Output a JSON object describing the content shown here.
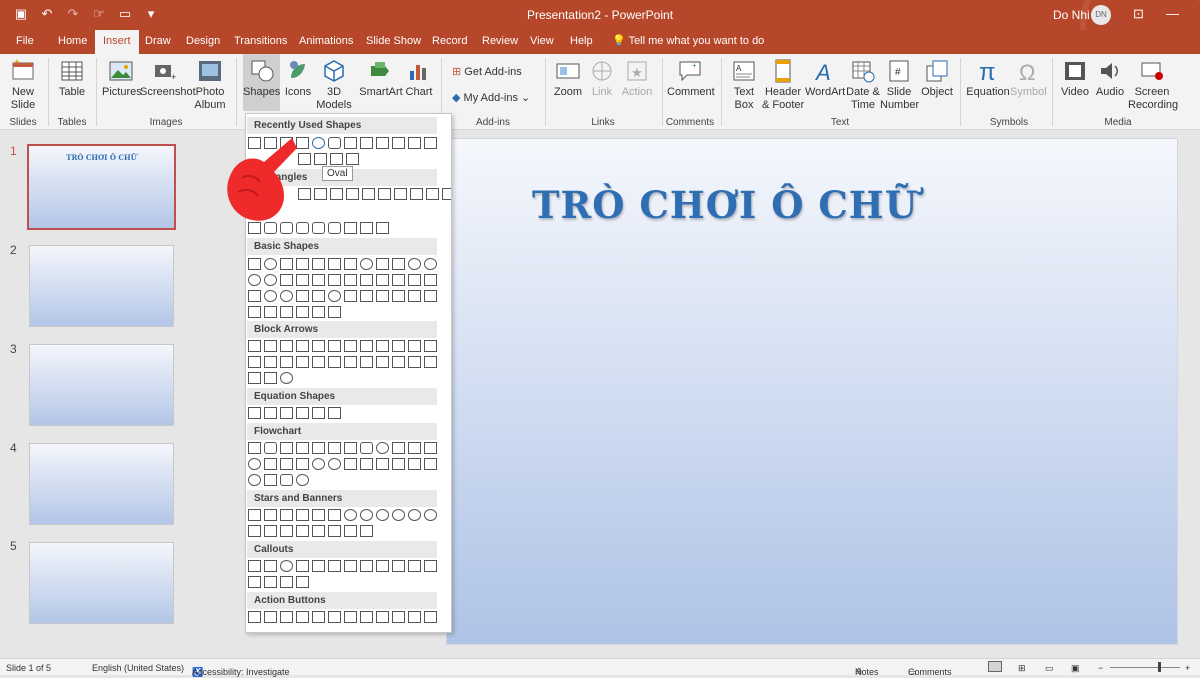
{
  "titlebar": {
    "title": "Presentation2 - PowerPoint",
    "user": "Do Nhi",
    "initials": "DN"
  },
  "tabs": [
    "File",
    "Home",
    "Insert",
    "Draw",
    "Design",
    "Transitions",
    "Animations",
    "Slide Show",
    "Record",
    "Review",
    "View",
    "Help"
  ],
  "tell_me": "Tell me what you want to do",
  "ribbon": {
    "new_slide": "New\nSlide",
    "table": "Table",
    "pictures": "Pictures",
    "screenshot": "Screenshot",
    "photo_album": "Photo\nAlbum",
    "shapes": "Shapes",
    "icons": "Icons",
    "models_3d": "3D\nModels",
    "smartart": "SmartArt",
    "chart": "Chart",
    "get_addins": "Get Add-ins",
    "my_addins": "My Add-ins",
    "zoom": "Zoom",
    "link": "Link",
    "action": "Action",
    "comment": "Comment",
    "text_box": "Text\nBox",
    "header_footer": "Header\n& Footer",
    "wordart": "WordArt",
    "date_time": "Date &\nTime",
    "slide_number": "Slide\nNumber",
    "object": "Object",
    "equation": "Equation",
    "symbol": "Symbol",
    "video": "Video",
    "audio": "Audio",
    "screen_recording": "Screen\nRecording",
    "groups": {
      "slides": "Slides",
      "tables": "Tables",
      "images": "Images",
      "addins": "Add-ins",
      "links": "Links",
      "comments": "Comments",
      "text": "Text",
      "symbols": "Symbols",
      "media": "Media"
    }
  },
  "gallery": {
    "sections": [
      "Recently Used Shapes",
      "Rectangles",
      "Basic Shapes",
      "Block Arrows",
      "Equation Shapes",
      "Flowchart",
      "Stars and Banners",
      "Callouts",
      "Action Buttons"
    ],
    "tooltip": "Oval"
  },
  "slides": {
    "numbers": [
      "1",
      "2",
      "3",
      "4",
      "5"
    ],
    "thumb_title": "TRÒ CHƠI Ô CHỮ"
  },
  "slide": {
    "title": "TRÒ CHƠI Ô CHỮ"
  },
  "status": {
    "slide": "Slide 1 of 5",
    "language": "English (United States)",
    "accessibility": "Accessibility: Investigate",
    "notes": "Notes",
    "comments": "Comments"
  },
  "colors": {
    "accent": "#b7472a",
    "title": "#2f6eb2"
  }
}
